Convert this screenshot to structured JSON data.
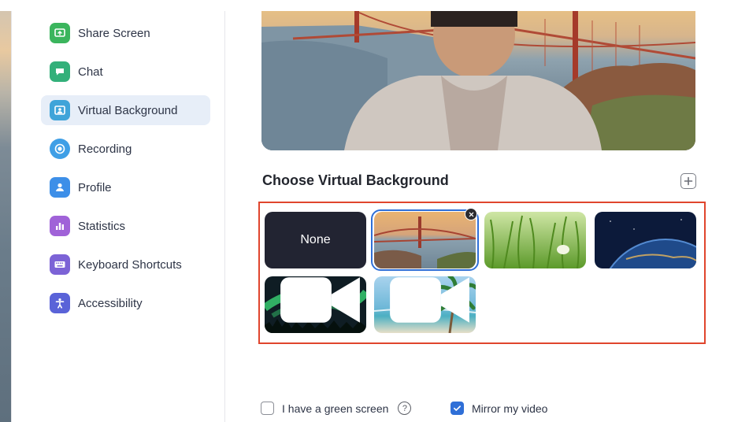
{
  "sidebar": {
    "items": [
      {
        "label": "Share Screen",
        "icon": "share-screen-icon",
        "color": "#3bb55d",
        "active": false
      },
      {
        "label": "Chat",
        "icon": "chat-icon",
        "color": "#33b07a",
        "active": false
      },
      {
        "label": "Virtual Background",
        "icon": "virtual-background-icon",
        "color": "#3fa4d9",
        "active": true
      },
      {
        "label": "Recording",
        "icon": "recording-icon",
        "color": "#3f9fe6",
        "active": false
      },
      {
        "label": "Profile",
        "icon": "profile-icon",
        "color": "#3d8fe8",
        "active": false
      },
      {
        "label": "Statistics",
        "icon": "statistics-icon",
        "color": "#a062d8",
        "active": false
      },
      {
        "label": "Keyboard Shortcuts",
        "icon": "keyboard-icon",
        "color": "#7c63d6",
        "active": false
      },
      {
        "label": "Accessibility",
        "icon": "accessibility-icon",
        "color": "#5a63d8",
        "active": false
      }
    ]
  },
  "main": {
    "section_title": "Choose Virtual Background",
    "backgrounds": [
      {
        "label": "None",
        "kind": "none",
        "selected": false
      },
      {
        "label": "",
        "kind": "golden-gate",
        "selected": true
      },
      {
        "label": "",
        "kind": "grass",
        "selected": false
      },
      {
        "label": "",
        "kind": "earth",
        "selected": false
      },
      {
        "label": "",
        "kind": "aurora",
        "selected": false,
        "video": true
      },
      {
        "label": "",
        "kind": "beach",
        "selected": false,
        "video": true
      }
    ]
  },
  "footer": {
    "green_screen_label": "I have a green screen",
    "green_screen_checked": false,
    "mirror_label": "Mirror my video",
    "mirror_checked": true
  },
  "colors": {
    "accent": "#2f6fd7",
    "highlight": "#e0452d",
    "active_item_bg": "#e7eef8"
  }
}
